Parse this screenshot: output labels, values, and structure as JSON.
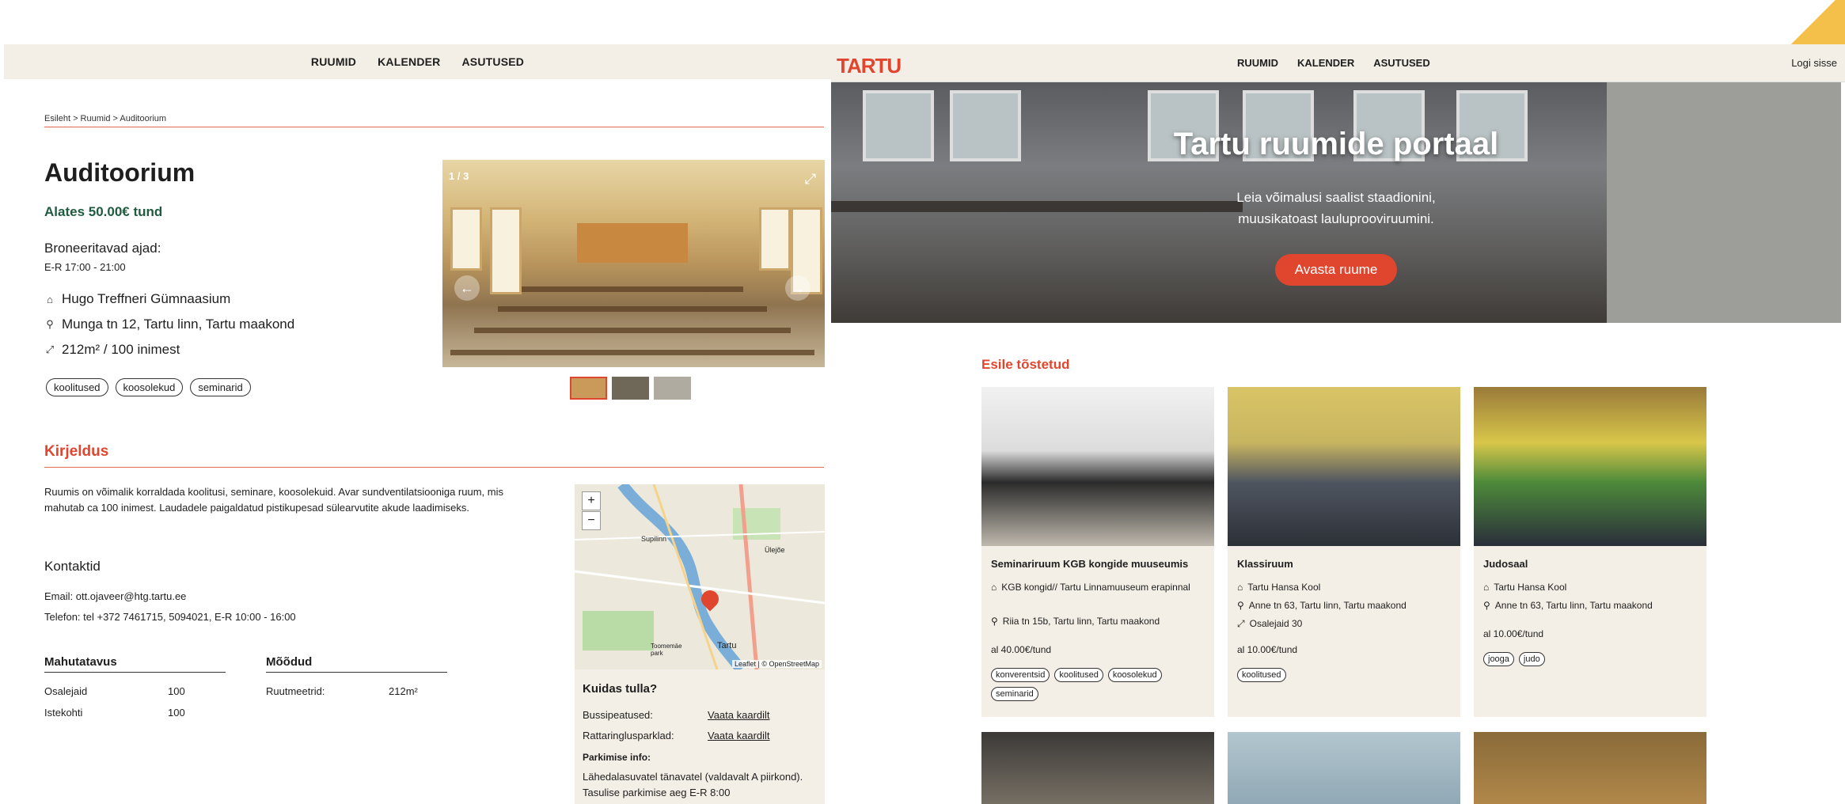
{
  "left": {
    "nav": [
      "RUUMID",
      "KALENDER",
      "ASUTUSED"
    ],
    "breadcrumb": "Esileht > Ruumid > Auditoorium",
    "title": "Auditoorium",
    "price": "Alates 50.00€ tund",
    "bookable_label": "Broneeritavad ajad:",
    "bookable_value": "E-R 17:00 - 21:00",
    "institution": "Hugo Treffneri Gümnaasium",
    "address": "Munga tn 12, Tartu linn, Tartu maakond",
    "size": "212m² / 100 inimest",
    "tags": [
      "koolitused",
      "koosolekud",
      "seminarid"
    ],
    "carousel_counter": "1 / 3",
    "description_heading": "Kirjeldus",
    "description": "Ruumis on võimalik korraldada koolitusi, seminare, koosolekuid. Avar sundventilatsiooniga ruum, mis mahutab ca 100 inimest. Laudadele paigaldatud pistikupesad sülearvutite akude laadimiseks.",
    "contact_heading": "Kontaktid",
    "email": "Email: ott.ojaveer@htg.tartu.ee",
    "phone": "Telefon: tel +372 7461715, 5094021, E-R 10:00 - 16:00",
    "capacity": {
      "heading": "Mahutatavus",
      "rows": [
        {
          "label": "Osalejaid",
          "value": "100"
        },
        {
          "label": "Istekohti",
          "value": "100"
        }
      ]
    },
    "dimensions": {
      "heading": "Mõõdud",
      "rows": [
        {
          "label": "Ruutmeetrid:",
          "value": "212m²"
        }
      ]
    },
    "map": {
      "zoom_in": "+",
      "zoom_out": "−",
      "attribution": "Leaflet | © OpenStreetMap",
      "labels": [
        "Supilinn",
        "Ülejõe",
        "Toomemäe park",
        "Tartu"
      ]
    },
    "how_to_get": {
      "heading": "Kuidas tulla?",
      "bus_label": "Bussipeatused:",
      "bus_link": "Vaata kaardilt",
      "bike_label": "Rattaringlusparklad:",
      "bike_link": "Vaata kaardilt",
      "parking_label": "Parkimise info:",
      "parking_text": "Lähedalasuvatel tänavatel (valdavalt A piirkond). Tasulise parkimise aeg E-R 8:00"
    }
  },
  "right": {
    "logo": "TARTU",
    "nav": [
      "RUUMID",
      "KALENDER",
      "ASUTUSED"
    ],
    "login": "Logi sisse",
    "hero_title": "Tartu ruumide portaal",
    "hero_subtitle": "Leia võimalusi saalist staadionini, muusikatoast lauluprooviruumini.",
    "hero_button": "Avasta ruume",
    "featured_heading": "Esile tõstetud",
    "cards": [
      {
        "title": "Seminariruum KGB kongide muuseumis",
        "institution": "KGB kongid// Tartu Linnamuuseum erapinnal",
        "address": "Riia tn 15b, Tartu linn, Tartu maakond",
        "size": "",
        "price": "al 40.00€/tund",
        "tags": [
          "konverentsid",
          "koolitused",
          "koosolekud",
          "seminarid"
        ]
      },
      {
        "title": "Klassiruum",
        "institution": "Tartu Hansa Kool",
        "address": "Anne tn 63, Tartu linn, Tartu maakond",
        "size": "Osalejaid 30",
        "price": "al 10.00€/tund",
        "tags": [
          "koolitused"
        ]
      },
      {
        "title": "Judosaal",
        "institution": "Tartu Hansa Kool",
        "address": "Anne tn 63, Tartu linn, Tartu maakond",
        "size": "",
        "price": "al 10.00€/tund",
        "tags": [
          "jooga",
          "judo"
        ]
      }
    ]
  },
  "colors": {
    "accent": "#e0452e",
    "beige": "#f4efe6",
    "green": "#1f5c3f"
  }
}
